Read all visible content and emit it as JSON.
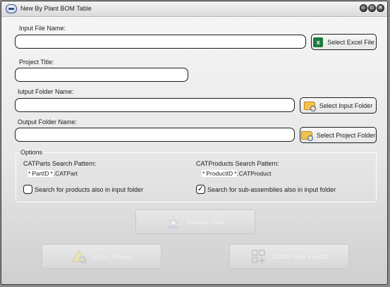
{
  "window": {
    "title": "New By Plant BOM Table",
    "controls": [
      "–",
      "□",
      "✕"
    ]
  },
  "input_file": {
    "label": "Input File Name:",
    "value": "",
    "button": "Select Excel File"
  },
  "project": {
    "label": "Project Title:",
    "value": ""
  },
  "input_folder": {
    "label": "Iutput Folder Name:",
    "value": "",
    "button": "Select Input Folder"
  },
  "output_folder": {
    "label": "Output Folder Name:",
    "value": "",
    "button": "Select Project Folder"
  },
  "options": {
    "legend": "Options",
    "catparts": {
      "label": "CATParts Search Pattern:",
      "star1": "*",
      "token": "PartID",
      "star2": "*",
      "ext": ".CATPart"
    },
    "catproducts": {
      "label": "CATProducts Search Pattern:",
      "star1": "*",
      "token": "ProductID",
      "star2": "*",
      "ext": ".CATProduct"
    },
    "search_products": {
      "label": "Search for products also in input folder",
      "checked": false
    },
    "search_subassemblies": {
      "label": "Search for sub-assemblies also in input folder",
      "checked": true,
      "mark": "✓"
    }
  },
  "actions": {
    "analyze": "Analyze Data",
    "errors": "Errors Viewer",
    "create_project": "Create New Project"
  },
  "icons": {
    "excel": "excel-icon",
    "folder": "folder-search-icon"
  },
  "colors": {
    "excel_green": "#1d7a3f",
    "folder_yellow": "#f3c24b"
  }
}
